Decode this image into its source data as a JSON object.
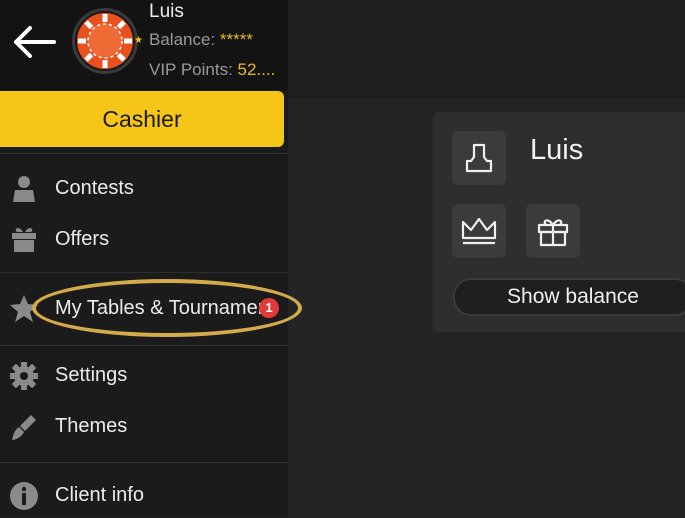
{
  "user": {
    "name": "Luis",
    "balance_label": "Balance:",
    "balance_value": "*****",
    "vip_label": "VIP Points:",
    "vip_value": "52...."
  },
  "menu": {
    "cashier_label": "Cashier",
    "items": [
      {
        "label": "Contests",
        "icon": "chess-king-icon"
      },
      {
        "label": "Offers",
        "icon": "gift-icon"
      },
      {
        "label": "My Tables & Tournaments",
        "icon": "star-icon",
        "badge": "1"
      },
      {
        "label": "Settings",
        "icon": "gear-icon"
      },
      {
        "label": "Themes",
        "icon": "brush-icon"
      },
      {
        "label": "Client info",
        "icon": "info-icon"
      }
    ]
  },
  "profile_card": {
    "name": "Luis",
    "show_balance_label": "Show balance"
  },
  "colors": {
    "accent": "#f5c518",
    "highlight_ring": "#d4aa4c",
    "badge": "#e03a3a",
    "avatar_chip": "#e8501f"
  }
}
